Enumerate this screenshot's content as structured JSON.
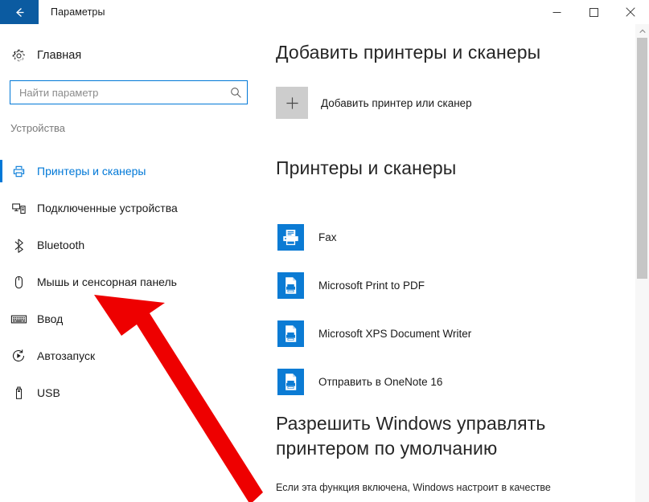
{
  "window": {
    "title": "Параметры",
    "back_icon": "back-arrow-icon",
    "minimize_label": "—",
    "maximize_label": "□",
    "close_label": "✕"
  },
  "sidebar": {
    "home": {
      "label": "Главная",
      "icon": "gear-icon"
    },
    "search": {
      "placeholder": "Найти параметр",
      "value": "",
      "icon": "search-icon"
    },
    "group_label": "Устройства",
    "items": [
      {
        "label": "Принтеры и сканеры",
        "icon": "printer-icon",
        "selected": true
      },
      {
        "label": "Подключенные устройства",
        "icon": "connected-devices-icon",
        "selected": false
      },
      {
        "label": "Bluetooth",
        "icon": "bluetooth-icon",
        "selected": false
      },
      {
        "label": "Мышь и сенсорная панель",
        "icon": "mouse-icon",
        "selected": false
      },
      {
        "label": "Ввод",
        "icon": "keyboard-icon",
        "selected": false
      },
      {
        "label": "Автозапуск",
        "icon": "autoplay-icon",
        "selected": false
      },
      {
        "label": "USB",
        "icon": "usb-icon",
        "selected": false
      }
    ]
  },
  "main": {
    "add_section": {
      "heading": "Добавить принтеры и сканеры",
      "add_button_label": "Добавить принтер или сканер",
      "add_button_icon": "plus-icon"
    },
    "printers_section": {
      "heading": "Принтеры и сканеры",
      "items": [
        {
          "name": "Fax",
          "icon": "fax-printer-icon"
        },
        {
          "name": "Microsoft Print to PDF",
          "icon": "document-printer-icon"
        },
        {
          "name": "Microsoft XPS Document Writer",
          "icon": "document-printer-icon"
        },
        {
          "name": "Отправить в OneNote 16",
          "icon": "document-printer-icon"
        }
      ]
    },
    "default_printer_section": {
      "heading": "Разрешить Windows управлять принтером по умолчанию",
      "description": "Если эта функция включена, Windows настроит в качестве"
    }
  },
  "scrollbar": {
    "up_arrow_icon": "chevron-up-icon"
  },
  "annotation": {
    "arrow_color": "#ee0000",
    "arrow_name": "red-pointer-arrow"
  },
  "colors": {
    "accent": "#0078d7",
    "titlebar_back": "#0b5ba1",
    "printer_icon_bg": "#0b7bd4"
  }
}
